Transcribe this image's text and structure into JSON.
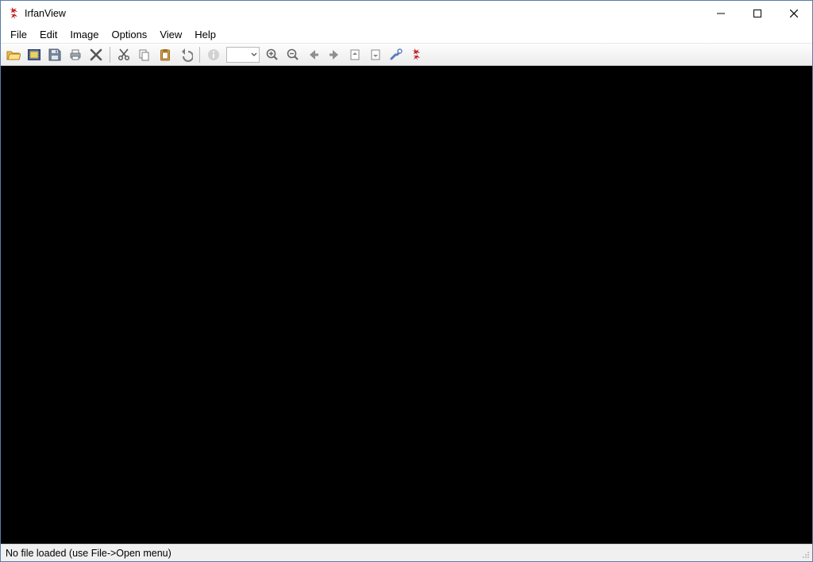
{
  "window": {
    "title": "IrfanView"
  },
  "menubar": {
    "items": [
      "File",
      "Edit",
      "Image",
      "Options",
      "View",
      "Help"
    ]
  },
  "toolbar": {
    "open": "Open",
    "slideshow": "Slideshow",
    "save": "Save",
    "print": "Print",
    "delete": "Delete",
    "cut": "Cut",
    "copy": "Copy",
    "paste": "Paste",
    "undo": "Undo",
    "info": "Image information",
    "zoom_combo": "",
    "zoom_in": "Zoom in",
    "zoom_out": "Zoom out",
    "prev": "Previous file",
    "next": "Next file",
    "prev_page": "Previous page",
    "next_page": "Next page",
    "settings": "Properties/Settings",
    "about": "About IrfanView"
  },
  "statusbar": {
    "text": "No file loaded (use File->Open menu)"
  }
}
